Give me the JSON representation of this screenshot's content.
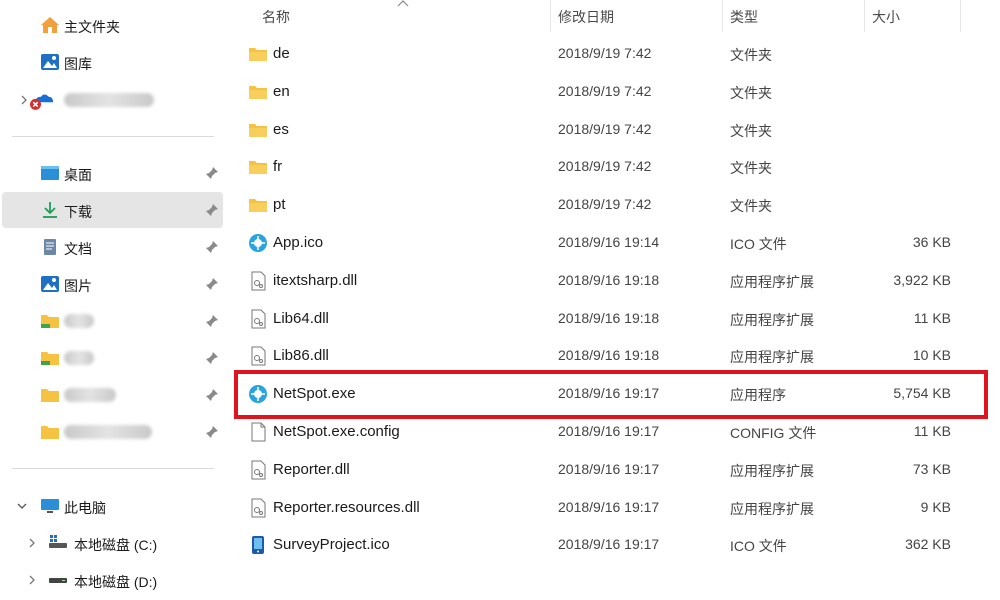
{
  "sidebar": {
    "home": "主文件夹",
    "gallery": "图库",
    "onedrive_error": "error",
    "quick_access": [
      {
        "label": "桌面",
        "icon": "desktop-icon"
      },
      {
        "label": "下载",
        "icon": "download-icon"
      },
      {
        "label": "文档",
        "icon": "document-icon"
      },
      {
        "label": "图片",
        "icon": "pictures-icon"
      }
    ],
    "this_pc": "此电脑",
    "drives": [
      {
        "label": "本地磁盘 (C:)"
      },
      {
        "label": "本地磁盘 (D:)"
      }
    ]
  },
  "columns": {
    "name": "名称",
    "modified": "修改日期",
    "type": "类型",
    "size": "大小"
  },
  "files": [
    {
      "name": "de",
      "date": "2018/9/19 7:42",
      "type": "文件夹",
      "size": "",
      "icon": "folder-icon"
    },
    {
      "name": "en",
      "date": "2018/9/19 7:42",
      "type": "文件夹",
      "size": "",
      "icon": "folder-icon"
    },
    {
      "name": "es",
      "date": "2018/9/19 7:42",
      "type": "文件夹",
      "size": "",
      "icon": "folder-icon"
    },
    {
      "name": "fr",
      "date": "2018/9/19 7:42",
      "type": "文件夹",
      "size": "",
      "icon": "folder-icon"
    },
    {
      "name": "pt",
      "date": "2018/9/19 7:42",
      "type": "文件夹",
      "size": "",
      "icon": "folder-icon"
    },
    {
      "name": "App.ico",
      "date": "2018/9/16 19:14",
      "type": "ICO 文件",
      "size": "36 KB",
      "icon": "app-icon"
    },
    {
      "name": "itextsharp.dll",
      "date": "2018/9/16 19:18",
      "type": "应用程序扩展",
      "size": "3,922 KB",
      "icon": "dll-icon"
    },
    {
      "name": "Lib64.dll",
      "date": "2018/9/16 19:18",
      "type": "应用程序扩展",
      "size": "11 KB",
      "icon": "dll-icon"
    },
    {
      "name": "Lib86.dll",
      "date": "2018/9/16 19:18",
      "type": "应用程序扩展",
      "size": "10 KB",
      "icon": "dll-icon"
    },
    {
      "name": "NetSpot.exe",
      "date": "2018/9/16 19:17",
      "type": "应用程序",
      "size": "5,754 KB",
      "icon": "app-icon"
    },
    {
      "name": "NetSpot.exe.config",
      "date": "2018/9/16 19:17",
      "type": "CONFIG 文件",
      "size": "11 KB",
      "icon": "file-icon"
    },
    {
      "name": "Reporter.dll",
      "date": "2018/9/16 19:17",
      "type": "应用程序扩展",
      "size": "73 KB",
      "icon": "dll-icon"
    },
    {
      "name": "Reporter.resources.dll",
      "date": "2018/9/16 19:17",
      "type": "应用程序扩展",
      "size": "9 KB",
      "icon": "dll-icon"
    },
    {
      "name": "SurveyProject.ico",
      "date": "2018/9/16 19:17",
      "type": "ICO 文件",
      "size": "362 KB",
      "icon": "survey-icon"
    }
  ],
  "highlighted_file": "NetSpot.exe",
  "colors": {
    "highlight": "#e0141e",
    "folder": "#f5c242",
    "selected_bg": "#e5e5e5"
  }
}
